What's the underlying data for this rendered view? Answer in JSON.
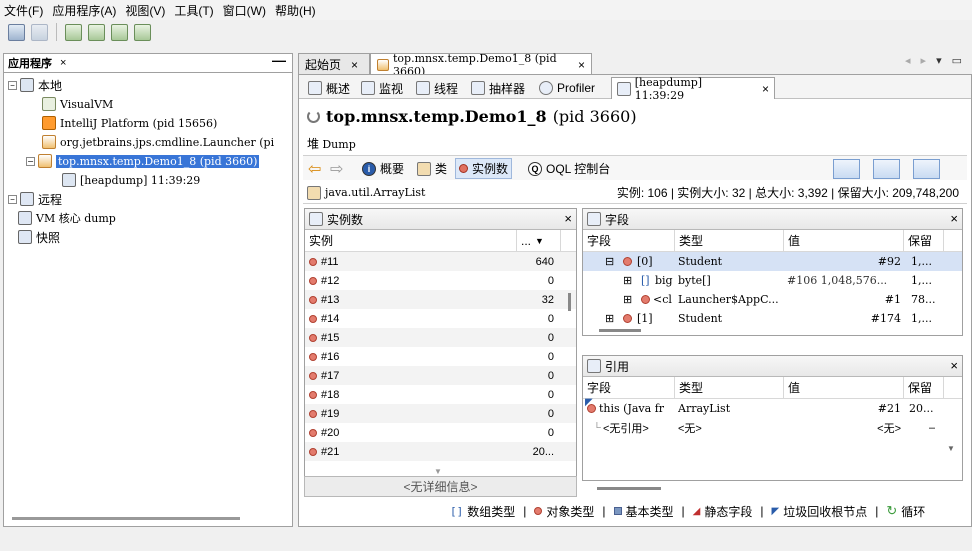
{
  "menu": [
    "文件(F)",
    "应用程序(A)",
    "视图(V)",
    "工具(T)",
    "窗口(W)",
    "帮助(H)"
  ],
  "left_panel": {
    "title": "应用程序",
    "close": "×",
    "minimize": "—",
    "tree": {
      "local": "本地",
      "visualvm": "VisualVM",
      "intellij": "IntelliJ Platform (pid 15656)",
      "launcher": "org.jetbrains.jps.cmdline.Launcher (pi",
      "demo": "top.mnsx.temp.Demo1_8 (pid 3660)",
      "heapdump": "[heapdump] 11:39:29",
      "remote": "远程",
      "coredump": "VM 核心 dump",
      "snapshot": "快照"
    }
  },
  "doc_tabs": {
    "start": "起始页",
    "demo": "top.mnsx.temp.Demo1_8 (pid 3660)",
    "close": "×"
  },
  "sub_tabs": {
    "overview": "概述",
    "monitor": "监视",
    "threads": "线程",
    "sampler": "抽样器",
    "profiler": "Profiler",
    "heapdump": "[heapdump] 11:39:29",
    "close": "×"
  },
  "heading": {
    "class_name": "top.mnsx.temp.Demo1_8",
    "pid": "(pid 3660)",
    "dump_label": "堆",
    "dump_word": "Dump"
  },
  "view_bar": {
    "summary": "概要",
    "classes": "类",
    "instances": "实例数",
    "oql": "OQL 控制台"
  },
  "class_line": {
    "name": "java.util.ArrayList",
    "stats": "实例: 106  |  实例大小: 32  |  总大小: 3,392  |  保留大小: 209,748,200"
  },
  "instances_panel": {
    "title": "实例数",
    "close": "×",
    "col_instance": "实例",
    "col_value": "...",
    "rows": [
      {
        "name": "#11",
        "value": "640"
      },
      {
        "name": "#12",
        "value": "0"
      },
      {
        "name": "#13",
        "value": "32"
      },
      {
        "name": "#14",
        "value": "0"
      },
      {
        "name": "#15",
        "value": "0"
      },
      {
        "name": "#16",
        "value": "0"
      },
      {
        "name": "#17",
        "value": "0"
      },
      {
        "name": "#18",
        "value": "0"
      },
      {
        "name": "#19",
        "value": "0"
      },
      {
        "name": "#20",
        "value": "0"
      },
      {
        "name": "#21",
        "value": "20..."
      }
    ],
    "no_details": "<无详细信息>"
  },
  "fields_panel": {
    "title": "字段",
    "close": "×",
    "cols": {
      "field": "字段",
      "type": "类型",
      "value": "值",
      "retained": "保留"
    },
    "rows": [
      {
        "field": "[0]",
        "type": "Student",
        "value": "#92",
        "retained": "1,..."
      },
      {
        "field": "big",
        "type": "byte[]",
        "value": "#106  1,048,576...",
        "retained": "1,..."
      },
      {
        "field": "<cl",
        "type": "Launcher$AppC...",
        "value": "#1",
        "retained": "78..."
      },
      {
        "field": "[1]",
        "type": "Student",
        "value": "#174",
        "retained": "1,..."
      }
    ]
  },
  "refs_panel": {
    "title": "引用",
    "close": "×",
    "cols": {
      "field": "字段",
      "type": "类型",
      "value": "值",
      "retained": "保留"
    },
    "rows": [
      {
        "field": "this (Java fr",
        "type": "ArrayList",
        "value": "#21",
        "retained": "20..."
      },
      {
        "field": "<无引用>",
        "type": "<无>",
        "value": "<无>",
        "retained": "–"
      }
    ]
  },
  "legend": {
    "array": "数组类型",
    "object": "对象类型",
    "primitive": "基本类型",
    "static": "静态字段",
    "gcroot": "垃圾回收根节点",
    "loop": "循环"
  }
}
